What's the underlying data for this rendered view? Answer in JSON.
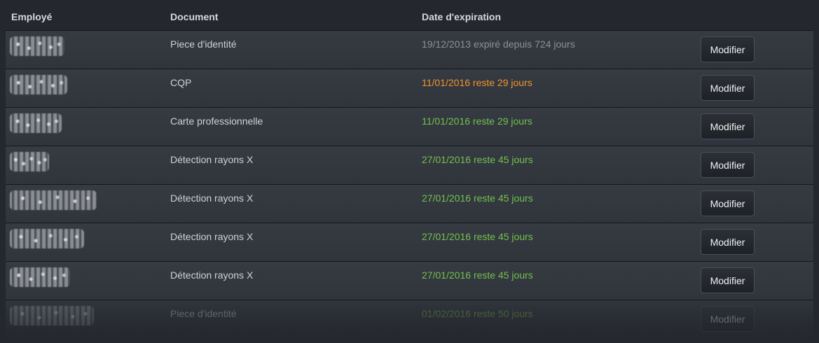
{
  "table": {
    "headers": {
      "employee": "Employé",
      "document": "Document",
      "expiration": "Date d'expiration"
    },
    "action_label": "Modifier",
    "rows": [
      {
        "document": "Piece d'identité",
        "expiration": "19/12/2013 expiré depuis 724 jours",
        "status": "expired"
      },
      {
        "document": "CQP",
        "expiration": "11/01/2016 reste 29 jours",
        "status": "warning"
      },
      {
        "document": "Carte professionnelle",
        "expiration": "11/01/2016 reste 29 jours",
        "status": "ok"
      },
      {
        "document": "Détection rayons X",
        "expiration": "27/01/2016 reste 45 jours",
        "status": "ok"
      },
      {
        "document": "Détection rayons X",
        "expiration": "27/01/2016 reste 45 jours",
        "status": "ok"
      },
      {
        "document": "Détection rayons X",
        "expiration": "27/01/2016 reste 45 jours",
        "status": "ok"
      },
      {
        "document": "Détection rayons X",
        "expiration": "27/01/2016 reste 45 jours",
        "status": "ok"
      },
      {
        "document": "Piece d'identité",
        "expiration": "01/02/2016 reste 50 jours",
        "status": "ok"
      }
    ]
  },
  "colors": {
    "background": "#24272d",
    "expired": "#8d9096",
    "warning": "#f0952d",
    "ok": "#71c24d"
  }
}
